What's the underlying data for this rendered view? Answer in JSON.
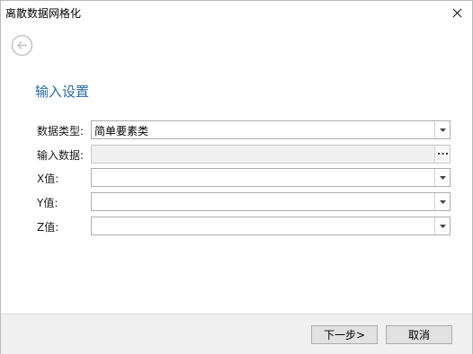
{
  "window": {
    "title": "离散数据网格化"
  },
  "section": {
    "title": "输入设置"
  },
  "form": {
    "data_type": {
      "label": "数据类型:",
      "value": "简单要素类"
    },
    "input_data": {
      "label": "输入数据:",
      "value": ""
    },
    "x_value": {
      "label": "X值:",
      "value": ""
    },
    "y_value": {
      "label": "Y值:",
      "value": ""
    },
    "z_value": {
      "label": "Z值:",
      "value": ""
    }
  },
  "footer": {
    "next_label": "下一步>",
    "cancel_label": "取消"
  },
  "icons": {
    "close": "close-icon",
    "back": "back-arrow-icon",
    "dropdown": "chevron-down-icon",
    "browse": "ellipsis-icon"
  },
  "colors": {
    "section_title": "#2a6aa8",
    "footer_bg": "#f0f0f0"
  }
}
